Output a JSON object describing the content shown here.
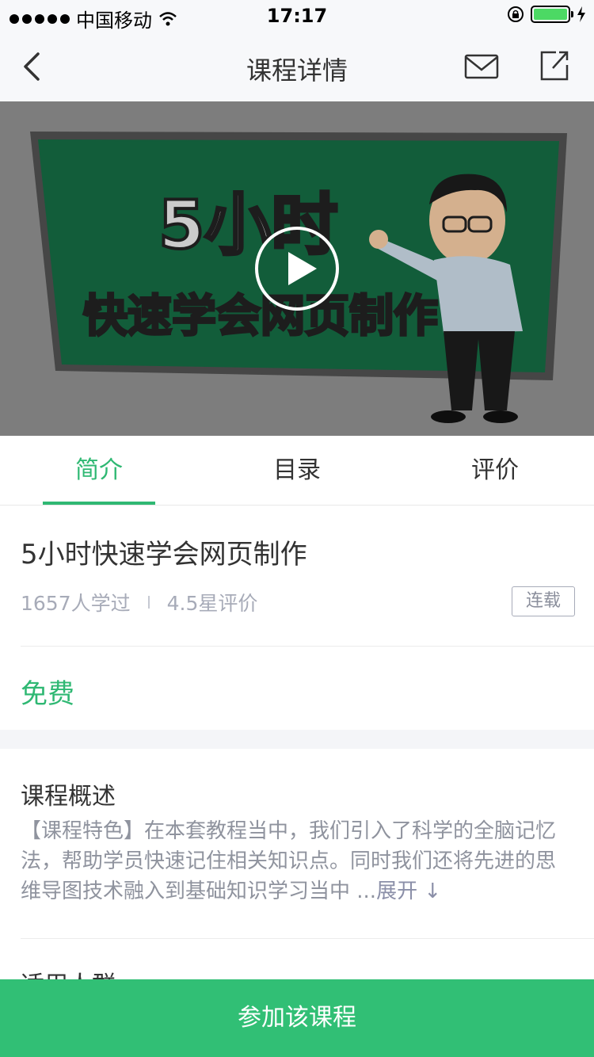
{
  "status_bar": {
    "carrier": "中国移动",
    "time": "17:17"
  },
  "nav": {
    "title": "课程详情"
  },
  "video": {
    "title_line1": "5小时",
    "title_line2": "快速学会网页制作"
  },
  "tabs": [
    {
      "label": "简介",
      "active": true
    },
    {
      "label": "目录",
      "active": false
    },
    {
      "label": "评价",
      "active": false
    }
  ],
  "course": {
    "title": "5小时快速学会网页制作",
    "learners": "1657人学过",
    "rating": "4.5星评价",
    "badge": "连载",
    "price": "免费"
  },
  "overview": {
    "heading": "课程概述",
    "text": "【课程特色】在本套教程当中，我们引入了科学的全脑记忆法，帮助学员快速记住相关知识点。同时我们还将先进的思维导图技术融入到基础知识学习当中 ...",
    "expand_label": "展开 ↓"
  },
  "next_section": {
    "heading": "适用人群"
  },
  "cta": {
    "label": "参加该课程"
  },
  "colors": {
    "accent": "#2fb873",
    "cta_background": "#31bf75",
    "video_background": "#8f8f8f",
    "chalkboard": "#156a43"
  }
}
